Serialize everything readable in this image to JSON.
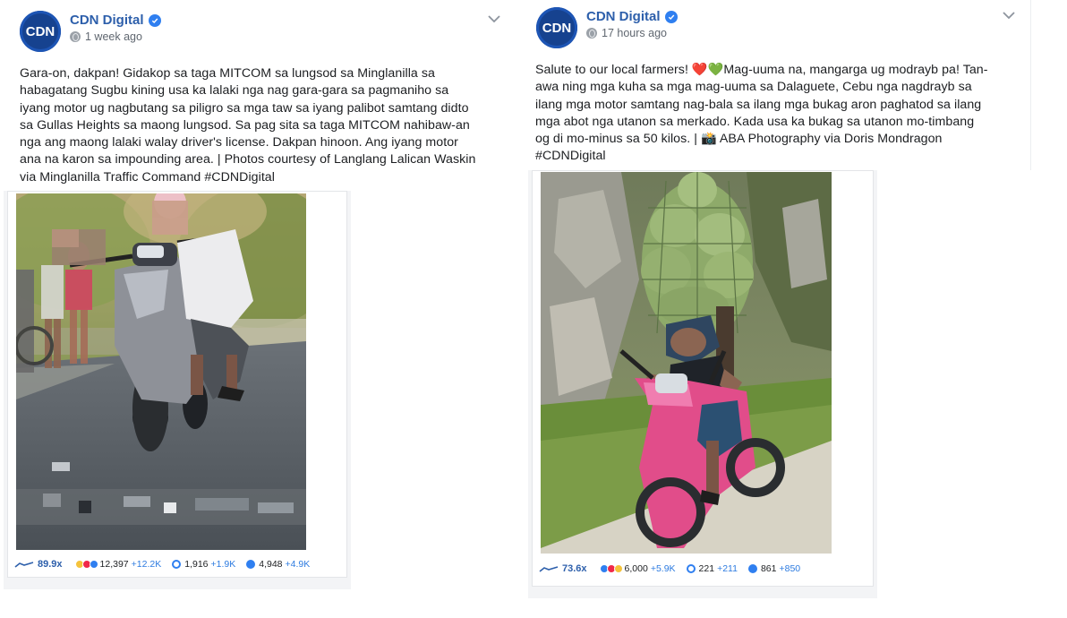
{
  "posts": [
    {
      "avatar_text": "CDN",
      "page_name": "CDN Digital",
      "time": "1 week ago",
      "lines": [
        "Gara-on, dakpan! Gidakop sa taga MITCOM sa lungsod sa Minglanilla sa",
        "habagatang Sugbu kining usa ka lalaki nga nag gara-gara sa pagmaniho sa",
        "iyang motor ug nagbutang sa piligro sa mga taw sa iyang palibot samtang didto",
        "sa Gullas Heights sa maong lungsod. Sa pag sita sa taga MITCOM nahibaw-an",
        "nga ang maong lalaki walay driver's license. Dakpan hinoon. Ang iyang motor",
        "ana na karon sa impounding area. | Photos courtesy of Langlang Lalican Waskin",
        "via Minglanilla Traffic Command #CDNDigital"
      ],
      "stats": {
        "trend": "89.9x",
        "reactions": "12,397",
        "reactions_delta": "+12.2K",
        "comments": "1,916",
        "comments_delta": "+1.9K",
        "shares": "4,948",
        "shares_delta": "+4.9K"
      }
    },
    {
      "avatar_text": "CDN",
      "page_name": "CDN Digital",
      "time": "17 hours ago",
      "lines": [
        "Salute to our local farmers! ❤️💚Mag-uuma na, mangarga ug modrayb pa! Tan-",
        "awa ning mga kuha sa mga mag-uuma sa Dalaguete, Cebu nga nagdrayb sa",
        "ilang mga motor samtang nag-bala sa ilang mga bukag aron paghatod sa ilang",
        "mga abot nga utanon sa merkado. Kada usa ka bukag sa utanon mo-timbang",
        "og di mo-minus sa 50 kilos. | 📸 ABA Photography via Doris Mondragon",
        "#CDNDigital"
      ],
      "stats": {
        "trend": "73.6x",
        "reactions": "6,000",
        "reactions_delta": "+5.9K",
        "comments": "221",
        "comments_delta": "+211",
        "shares": "861",
        "shares_delta": "+850"
      }
    }
  ],
  "colors": {
    "brand_blue": "#2d5fab",
    "avatar_bg": "#16428f",
    "verified": "#2f7ff0",
    "delta_blue": "#2d7be0"
  },
  "icons": {
    "verified": "verified-badge-icon",
    "globe": "globe-icon",
    "menu": "chevron-down-icon",
    "trend": "trend-line-icon",
    "reactions": "reaction-emoji-icons",
    "comments": "comment-icon",
    "shares": "share-icon"
  }
}
